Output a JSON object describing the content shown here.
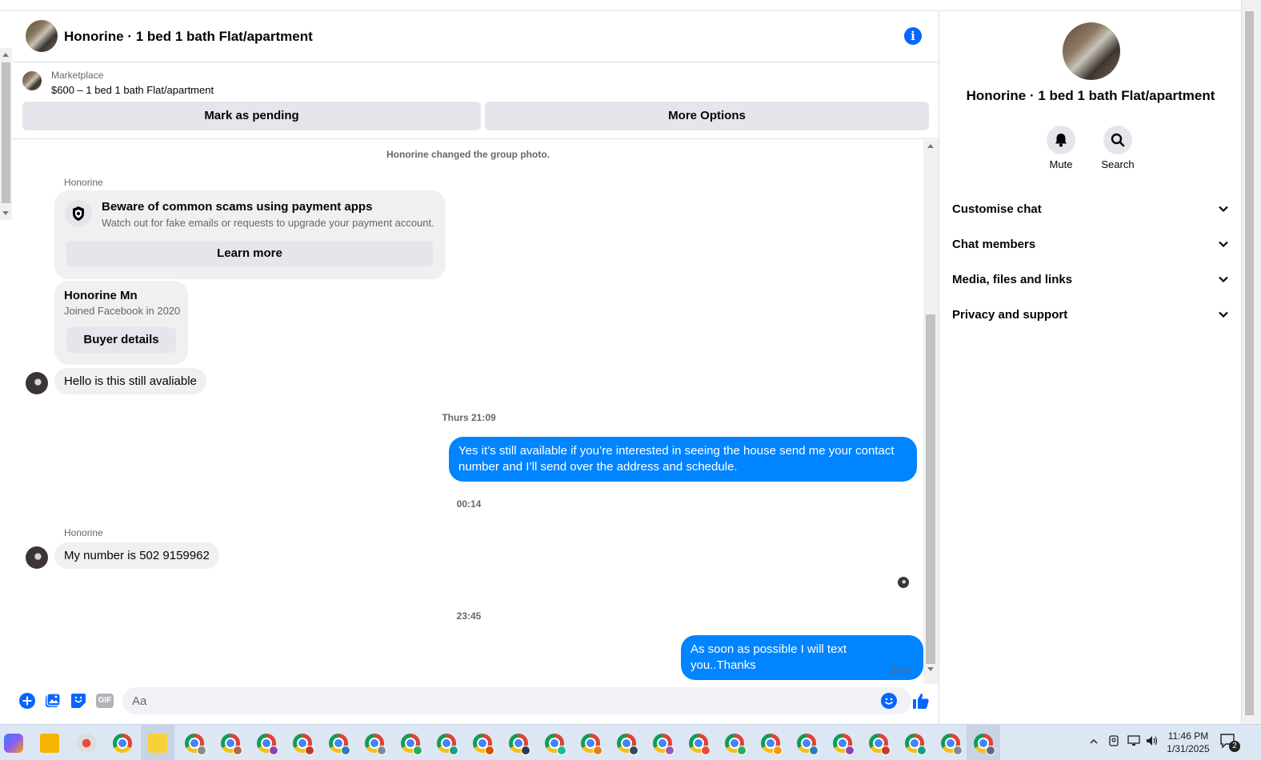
{
  "header": {
    "title": "Honorine · 1 bed 1 bath Flat/apartment",
    "info_icon": "info-icon"
  },
  "marketplace": {
    "label": "Marketplace",
    "item": "$600 – 1 bed 1 bath Flat/apartment",
    "mark_pending": "Mark as pending",
    "more_options": "More Options"
  },
  "messages": {
    "system_note": "Honorine changed the group photo.",
    "sender_1": "Honorine",
    "scam_title": "Beware of common scams using payment apps",
    "scam_body": "Watch out for fake emails or requests to upgrade your payment account.",
    "learn_more": "Learn more",
    "buyer_name": "Honorine Mn",
    "buyer_joined": "Joined Facebook in 2020",
    "buyer_details": "Buyer details",
    "msg_1": "Hello is this still avaliable",
    "time_1": "Thurs 21:09",
    "msg_2": "Yes it’s still available if you’re interested in seeing the house send me your contact number and I’ll send over the address and schedule.",
    "time_2": "00:14",
    "sender_2": "Honorine",
    "msg_3": "My number is 502 9159962",
    "time_3": "23:45",
    "msg_4": "As soon as possible I will text you..Thanks",
    "status": "Sent"
  },
  "composer": {
    "placeholder": "Aa",
    "icons": [
      "plus-icon",
      "photo-icon",
      "sticker-icon",
      "gif-icon",
      "emoji-icon",
      "thumbs-up-icon"
    ],
    "gif_label": "GIF"
  },
  "right_panel": {
    "title": "Honorine · 1 bed 1 bath Flat/apartment",
    "mute": "Mute",
    "search": "Search",
    "sections": [
      "Customise chat",
      "Chat members",
      "Media, files and links",
      "Privacy and support"
    ]
  },
  "taskbar": {
    "time": "11:46 PM",
    "date": "1/31/2025",
    "notification_count": "2"
  },
  "colors": {
    "accent": "#0866ff",
    "outgoing_bubble": "#0084ff",
    "incoming_bubble": "#f0f0f0"
  }
}
